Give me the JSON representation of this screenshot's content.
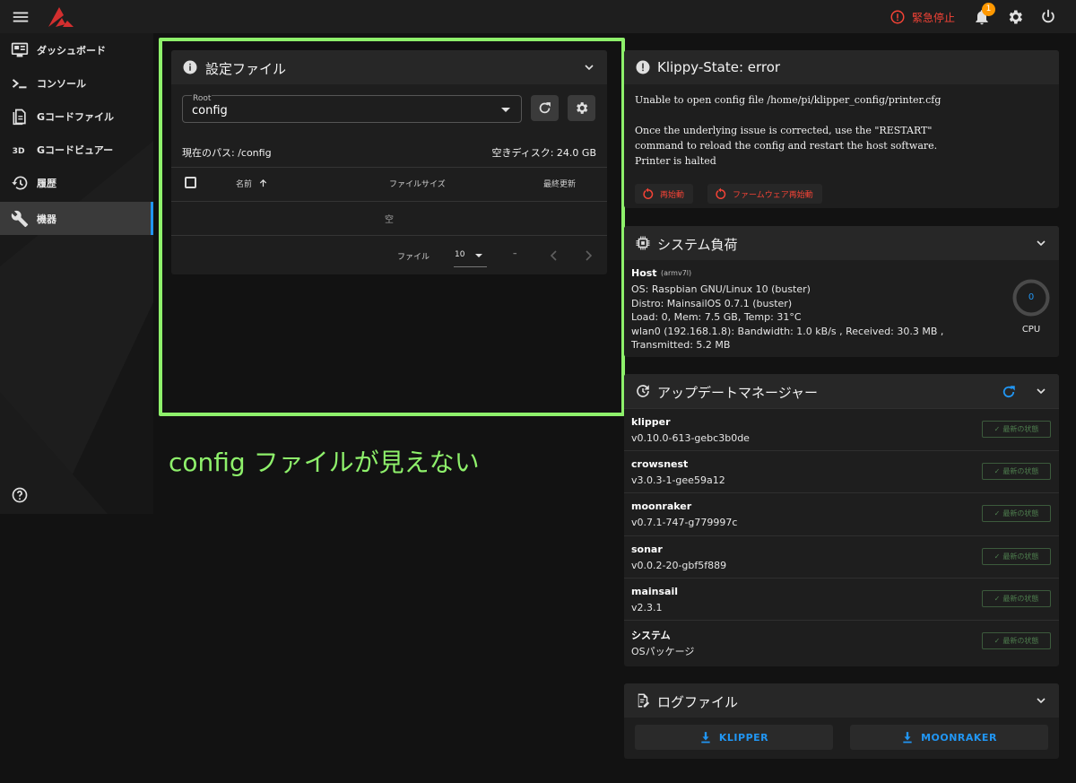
{
  "topbar": {
    "estop_label": "緊急停止",
    "notification_count": "1"
  },
  "sidebar": {
    "items": [
      {
        "label": "ダッシュボード",
        "icon": "monitor-dashboard-icon"
      },
      {
        "label": "コンソール",
        "icon": "console-icon"
      },
      {
        "label": "Gコードファイル",
        "icon": "file-document-icon"
      },
      {
        "label": "Gコードビュアー",
        "icon": "3d-icon"
      },
      {
        "label": "履歴",
        "icon": "history-icon"
      },
      {
        "label": "機器",
        "icon": "wrench-icon",
        "active": true
      }
    ]
  },
  "config_panel": {
    "title": "設定ファイル",
    "root_label": "Root",
    "root_value": "config",
    "current_path": "現在のパス: /config",
    "free_disk": "空きディスク: 24.0 GB",
    "columns": [
      "名前",
      "ファイルサイズ",
      "最終更新"
    ],
    "empty_text": "空",
    "pagination": {
      "label": "ファイル",
      "per_page": "10",
      "range": "–"
    }
  },
  "annotation": {
    "text": "config ファイルが見えない",
    "color": "#8ef06b"
  },
  "klippy": {
    "title": "Klippy-State: error",
    "lines": [
      "Unable to open config file /home/pi/klipper_config/printer.cfg",
      "",
      "Once the underlying issue is corrected, use the \"RESTART\"",
      "command to reload the config and restart the host software.",
      "Printer is halted"
    ],
    "restart_label": "再始動",
    "firmware_restart_label": "ファームウェア再始動"
  },
  "system_load": {
    "title": "システム負荷",
    "host_label": "Host",
    "host_arch": "(armv7l)",
    "lines": [
      "OS: Raspbian GNU/Linux 10 (buster)",
      "Distro: MainsailOS 0.7.1 (buster)",
      "Load: 0, Mem: 7.5 GB, Temp: 31°C",
      "wlan0 (192.168.1.8): Bandwidth: 1.0 kB/s , Received: 30.3 MB ,",
      "Transmitted: 5.2 MB"
    ],
    "cpu_value": "0",
    "cpu_label": "CPU"
  },
  "update_manager": {
    "title": "アップデートマネージャー",
    "status_label": "最新の状態",
    "items": [
      {
        "name": "klipper",
        "version": "v0.10.0-613-gebc3b0de"
      },
      {
        "name": "crowsnest",
        "version": "v3.0.3-1-gee59a12"
      },
      {
        "name": "moonraker",
        "version": "v0.7.1-747-g779997c"
      },
      {
        "name": "sonar",
        "version": "v0.0.2-20-gbf5f889"
      },
      {
        "name": "mainsail",
        "version": "v2.3.1"
      },
      {
        "name": "システム",
        "version": "OSパッケージ"
      }
    ]
  },
  "logs": {
    "title": "ログファイル",
    "buttons": [
      "KLIPPER",
      "MOONRAKER"
    ]
  },
  "colors": {
    "accent": "#2196f3",
    "error": "#f44336",
    "warning_badge": "#ff9800",
    "highlight": "#8ef06b",
    "success_muted": "#4f7f4f"
  }
}
